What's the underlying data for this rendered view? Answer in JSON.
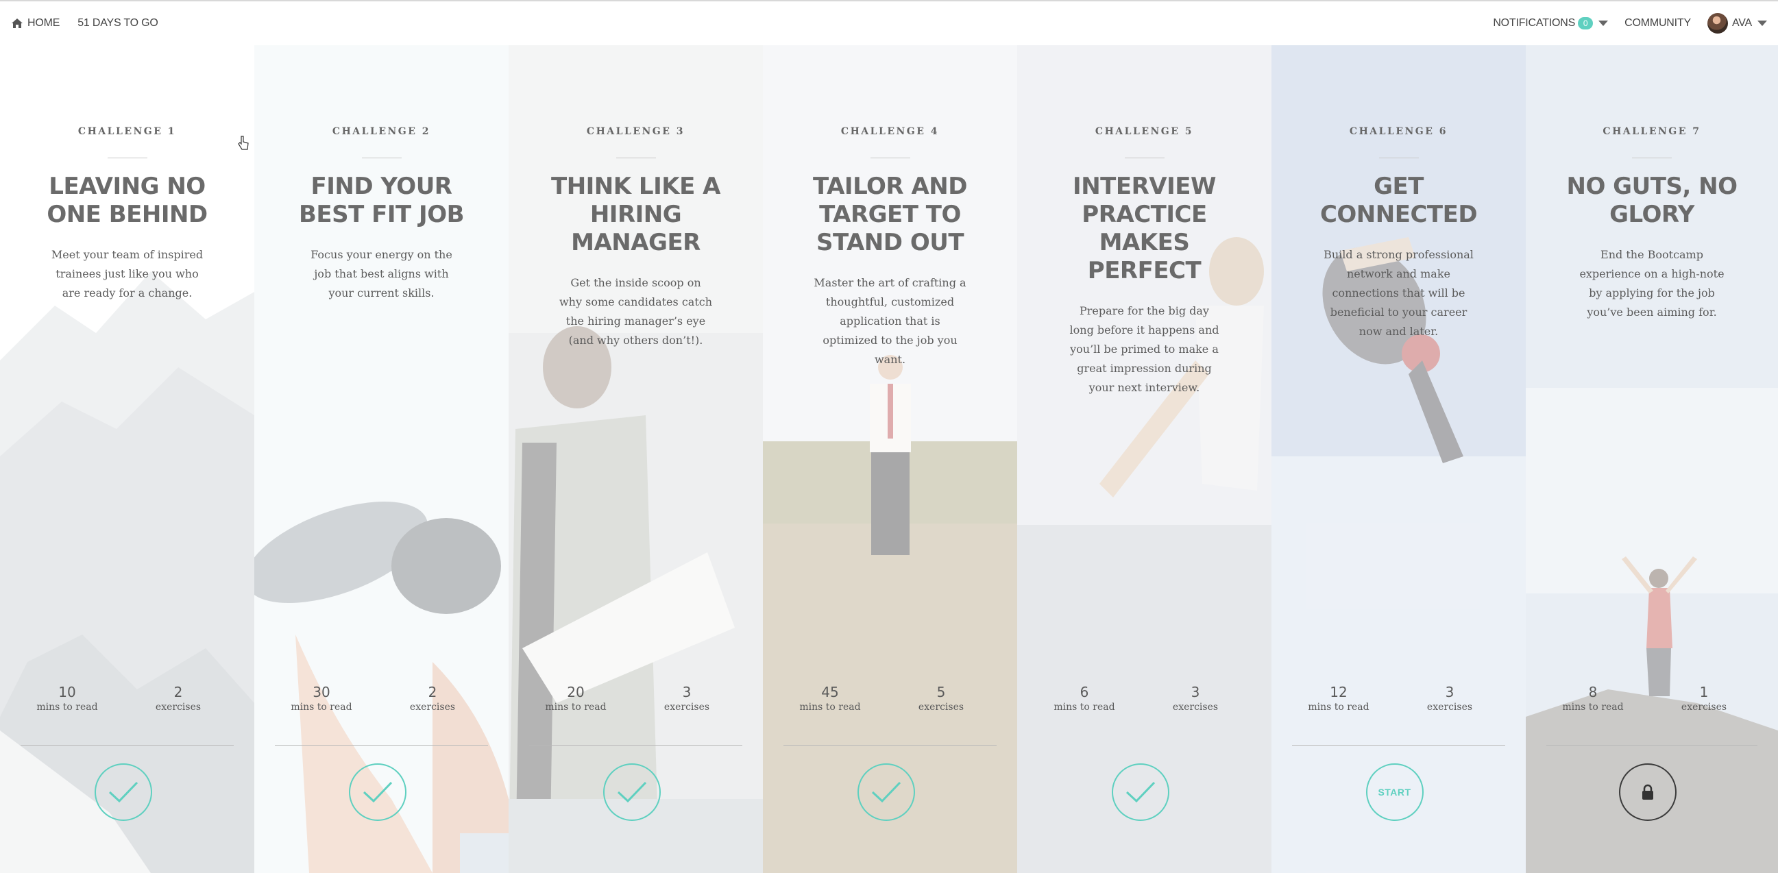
{
  "nav": {
    "home_label": "HOME",
    "days_label": "51 DAYS TO GO",
    "notifications_label": "NOTIFICATIONS",
    "notifications_count": "0",
    "community_label": "COMMUNITY",
    "user_label": "AVA"
  },
  "accent_color": "#5fd0c0",
  "challenges": [
    {
      "label": "CHALLENGE 1",
      "title": "LEAVING NO ONE BEHIND",
      "description": "Meet your team of inspired trainees just like you who are ready for a change.",
      "mins": "10",
      "mins_label": "mins to read",
      "exercises": "2",
      "exercises_label": "exercises",
      "status": "completed",
      "icon": "check-icon"
    },
    {
      "label": "CHALLENGE 2",
      "title": "FIND YOUR BEST FIT JOB",
      "description": "Focus your energy on the job that best aligns with your current skills.",
      "mins": "30",
      "mins_label": "mins to read",
      "exercises": "2",
      "exercises_label": "exercises",
      "status": "completed",
      "icon": "check-icon"
    },
    {
      "label": "CHALLENGE 3",
      "title": "THINK LIKE A HIRING MANAGER",
      "description": "Get the inside scoop on why some candidates catch the hiring manager’s eye (and why others don’t!).",
      "mins": "20",
      "mins_label": "mins to read",
      "exercises": "3",
      "exercises_label": "exercises",
      "status": "completed",
      "icon": "check-icon"
    },
    {
      "label": "CHALLENGE 4",
      "title": "TAILOR AND TARGET TO STAND OUT",
      "description": "Master the art of crafting a thoughtful, customized application that is optimized to the job you want.",
      "mins": "45",
      "mins_label": "mins to read",
      "exercises": "5",
      "exercises_label": "exercises",
      "status": "completed",
      "icon": "check-icon"
    },
    {
      "label": "CHALLENGE 5",
      "title": "INTERVIEW PRACTICE MAKES PERFECT",
      "description": "Prepare for the big day long before it happens and you’ll be primed to make a great impression during your next interview.",
      "mins": "6",
      "mins_label": "mins to read",
      "exercises": "3",
      "exercises_label": "exercises",
      "status": "completed",
      "icon": "check-icon"
    },
    {
      "label": "CHALLENGE 6",
      "title": "GET CONNECTED",
      "description": "Build a strong professional network and make connections that will be beneficial to your career now and later.",
      "mins": "12",
      "mins_label": "mins to read",
      "exercises": "3",
      "exercises_label": "exercises",
      "status": "start",
      "action_label": "START"
    },
    {
      "label": "CHALLENGE 7",
      "title": "NO GUTS, NO GLORY",
      "description": "End the Bootcamp experience on a high-note by applying for the job you’ve been aiming for.",
      "mins": "8",
      "mins_label": "mins to read",
      "exercises": "1",
      "exercises_label": "exercises",
      "status": "locked",
      "icon": "lock-icon"
    }
  ]
}
